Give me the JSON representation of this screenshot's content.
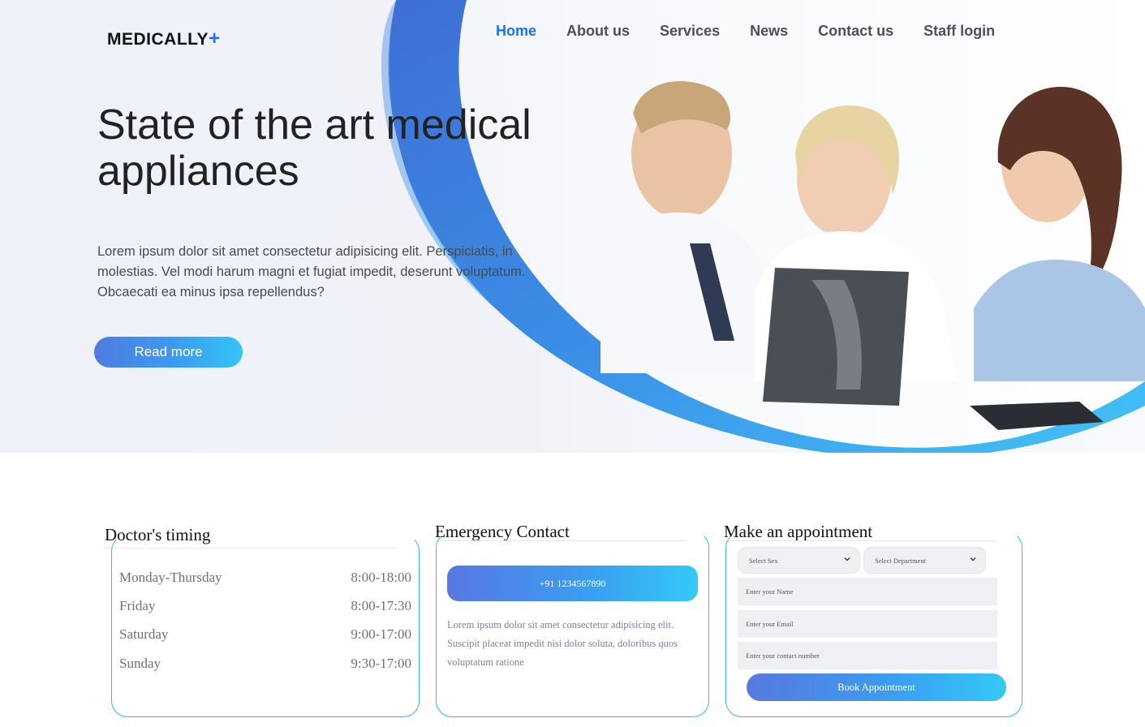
{
  "brand": {
    "name": "MEDICALLY",
    "plus": "+"
  },
  "nav": {
    "items": [
      {
        "label": "Home",
        "active": true
      },
      {
        "label": "About us"
      },
      {
        "label": "Services"
      },
      {
        "label": "News"
      },
      {
        "label": "Contact us"
      },
      {
        "label": "Staff login"
      }
    ]
  },
  "hero": {
    "title": "State of the art medical appliances",
    "text": "Lorem ipsum dolor sit amet consectetur adipisicing elit. Perspiciatis, in molestias. Vel modi harum magni et fugiat impedit, deserunt voluptatum. Obcaecati ea minus ipsa repellendus?",
    "button": "Read more"
  },
  "timing": {
    "title": "Doctor's timing",
    "rows": [
      {
        "day": "Monday-Thursday",
        "hours": "8:00-18:00"
      },
      {
        "day": "Friday",
        "hours": "8:00-17:30"
      },
      {
        "day": "Saturday",
        "hours": "9:00-17:00"
      },
      {
        "day": "Sunday",
        "hours": "9:30-17:00"
      }
    ]
  },
  "emergency": {
    "title": "Emergency Contact",
    "phone": "+91 1234567890",
    "text": "Lorem ipsum dolor sit amet consectetur adipisicing elit. Suscipit placeat impedit nisi dolor soluta, doloribus quos voluptatum ratione"
  },
  "appointment": {
    "title": "Make an appointment",
    "sex_select": "Select Sex",
    "department_select": "Select Department",
    "name_placeholder": "Enter your Name",
    "email_placeholder": "Enter your Email",
    "contact_placeholder": "Enter your contact number",
    "button": "Book Appointment"
  },
  "colors": {
    "accent": "#1a73e8",
    "frame": "#38b6f0",
    "gradient_start": "#4f7be0",
    "gradient_end": "#35c4f8"
  }
}
